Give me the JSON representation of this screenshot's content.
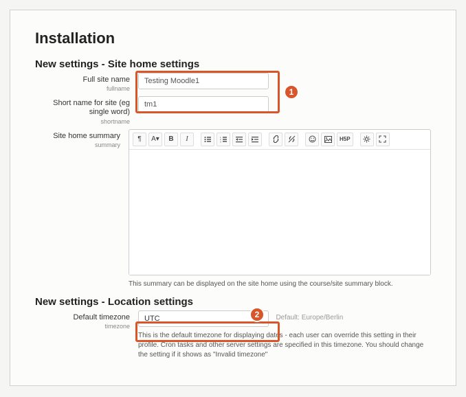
{
  "page_title": "Installation",
  "section1": {
    "heading": "New settings - Site home settings",
    "fullname": {
      "label": "Full site name",
      "sub": "fullname",
      "value": "Testing Moodle1"
    },
    "shortname": {
      "label": "Short name for site (eg single word)",
      "sub": "shortname",
      "value": "tm1"
    },
    "summary": {
      "label": "Site home summary",
      "sub": "summary",
      "help": "This summary can be displayed on the site home using the course/site summary block."
    }
  },
  "section2": {
    "heading": "New settings - Location settings",
    "timezone": {
      "label": "Default timezone",
      "sub": "timezone",
      "value": "UTC",
      "default_note": "Default: Europe/Berlin",
      "help": "This is the default timezone for displaying dates - each user can override this setting in their profile. Cron tasks and other server settings are specified in this timezone. You should change the setting if it shows as \"Invalid timezone\""
    }
  },
  "toolbar": {
    "paragraph": "¶",
    "fontsize": "A▾",
    "bold": "B",
    "italic": "I",
    "h5p": "H5P"
  },
  "annotations": {
    "one": "1",
    "two": "2"
  }
}
